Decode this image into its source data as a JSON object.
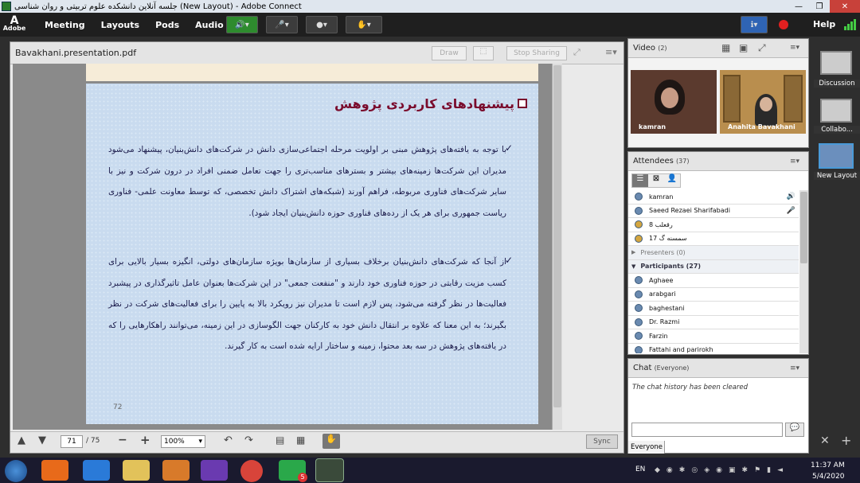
{
  "window": {
    "title": "جلسه آنلاین دانشکده علوم تربیتی و روان شناسی (New Layout) - Adobe Connect"
  },
  "menu": {
    "logo": "Adobe",
    "items": [
      "Meeting",
      "Layouts",
      "Pods",
      "Audio"
    ],
    "help": "Help"
  },
  "share": {
    "filename": "Bavakhani.presentation.pdf",
    "draw": "Draw",
    "stop": "Stop Sharing",
    "sync": "Sync",
    "page_current": "71",
    "page_total": "/ 75",
    "zoom": "100%"
  },
  "slide": {
    "title": "پیشنهادهای کاربردی پژوهش",
    "bullet1": "با توجه به یافته‌های پژوهش مبنی بر اولویت مرحله اجتماعی‌سازی دانش در شرکت‌های دانش‌بنیان، پیشنهاد می‌شود مدیران این شرکت‌ها زمینه‌های بیشتر و بسترهای مناسب‌تری را جهت تعامل ضمنی افراد در درون شرکت و نیز با سایر شرکت‌های فناوری مربوطه، فراهم آورند (شبکه‌های اشتراک دانش تخصصی، که توسط معاونت علمی- فناوری ریاست جمهوری برای هر یک از رده‌های فناوری حوزه دانش‌بنیان ایجاد شود).",
    "bullet2": "از آنجا که شرکت‌های دانش‌بنیان برخلاف بسیاری از سازمان‌ها بویژه سازمان‌های دولتی، انگیزه بسیار بالایی برای کسب مزیت رقابتی در حوزه فناوری خود دارند و \"منفعت جمعی\" در این شرکت‌ها بعنوان عامل تاثیرگذاری در پیشبرد فعالیت‌ها در نظر گرفته می‌شود، پس لازم است تا مدیران نیز رویکرد بالا به پایین را برای فعالیت‌های شرکت در نظر بگیرند؛ به این معنا که علاوه بر انتقال دانش خود به کارکنان جهت الگوسازی در این زمینه، می‌توانند راهکارهایی را که در یافته‌های پژوهش در سه بعد محتوا، زمینه و ساختار ارایه شده است به کار گیرند.",
    "number": "72"
  },
  "video": {
    "title": "Video",
    "count": "(2)",
    "names": [
      "kamran",
      "Anahita Bavakhani"
    ]
  },
  "attendees": {
    "title": "Attendees",
    "count": "(37)",
    "hosts": [
      "kamran",
      "Saeed Rezaei Sharifabadi",
      "8 رقعلب",
      "17 سمسنه گ"
    ],
    "presenters": "Presenters (0)",
    "participants_label": "Participants (27)",
    "participants": [
      "Aghaee",
      "arabgari",
      "baghestani",
      "Dr. Razmi",
      "Farzin",
      "Fattahi and parirokh"
    ]
  },
  "chat": {
    "title": "Chat",
    "scope": "(Everyone)",
    "history": "The chat history has been cleared",
    "tab": "Everyone"
  },
  "rail": {
    "items": [
      "Discussion",
      "Collabo...",
      "New Layout"
    ]
  },
  "taskbar": {
    "lang": "EN",
    "time": "11:37 AM",
    "date": "5/4/2020",
    "badge": "5"
  }
}
